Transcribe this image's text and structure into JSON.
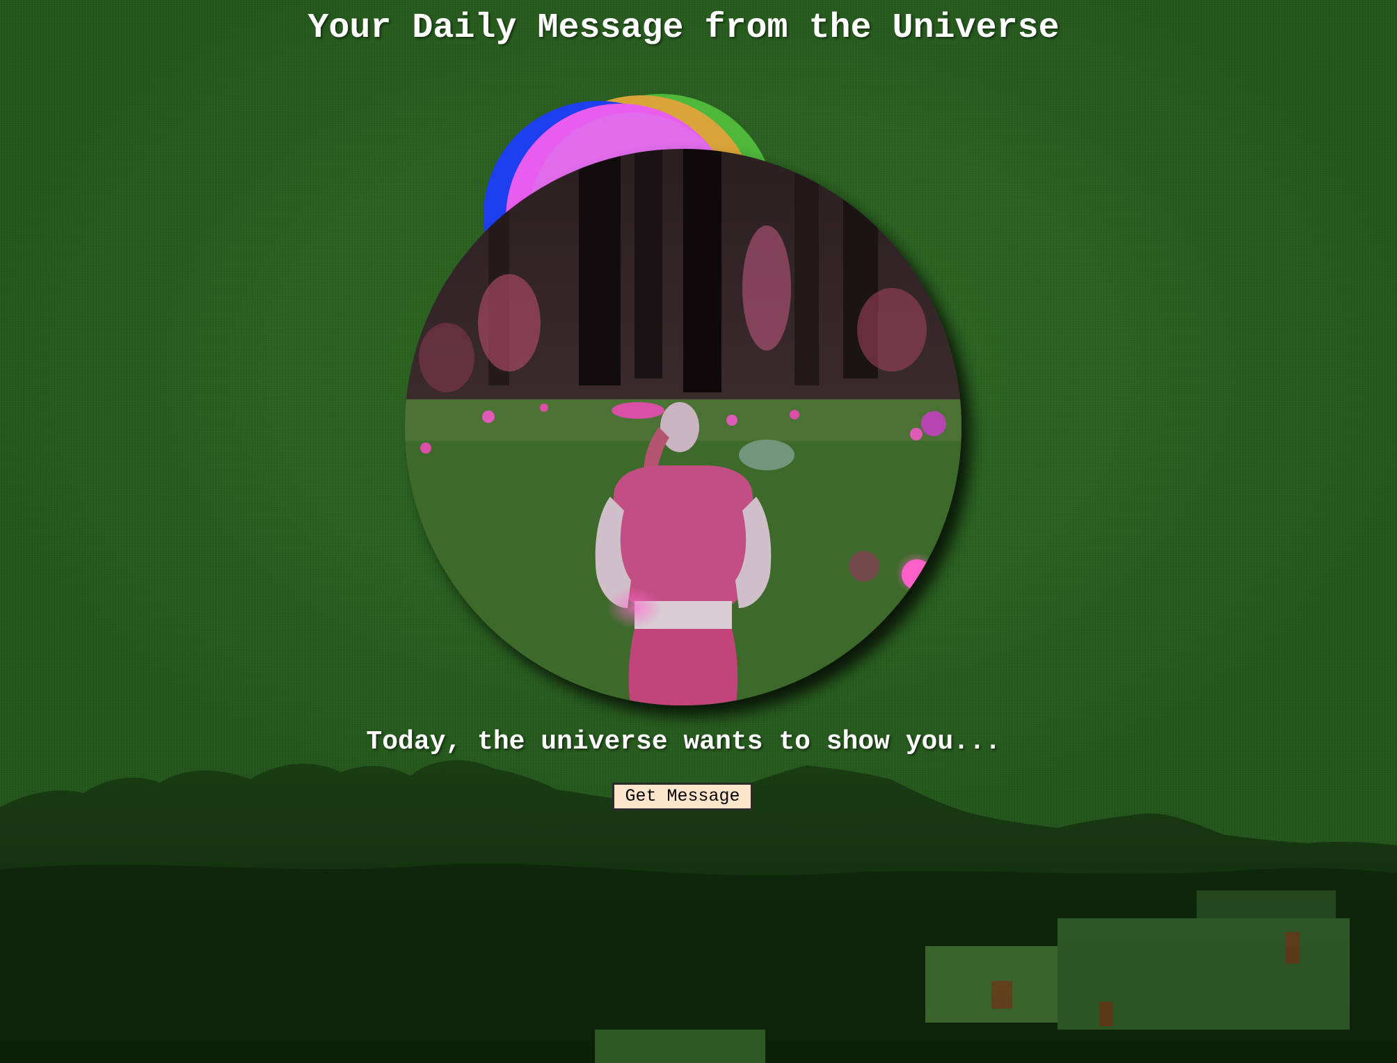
{
  "page": {
    "title": "Your Daily Message from the Universe",
    "subtitle": "Today, the universe wants to show you...",
    "button_label": "Get Message"
  },
  "colors": {
    "background": "#2a6320",
    "text": "#ffffff",
    "button_bg": "#fde5cc",
    "moon_blue": "#1d3ff0",
    "moon_magenta": "#e85cf0",
    "moon_orange": "#d9a43a",
    "moon_green": "#4db83a"
  },
  "icons": {
    "orb_image": "forest-figure-image",
    "moons": "layered-moons-graphic",
    "landscape": "trees-houses-silhouette"
  }
}
